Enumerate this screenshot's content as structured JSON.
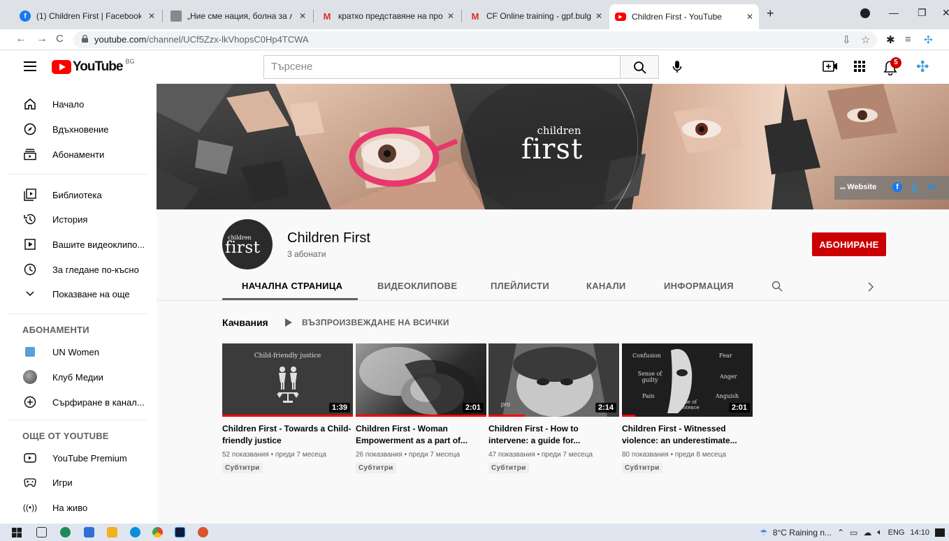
{
  "browser": {
    "tabs": [
      {
        "title": "(1) Children First | Facebook",
        "favicon": "facebook-icon",
        "color": "#1877f2"
      },
      {
        "title": "„Ние сме нация, болна за любо",
        "favicon": "site-icon",
        "color": "#888888"
      },
      {
        "title": "кратко представяне на проекта",
        "favicon": "gmail-icon",
        "color": "#d93025"
      },
      {
        "title": "CF Online training - gpf.bulgaria",
        "favicon": "gmail-icon",
        "color": "#d93025"
      },
      {
        "title": "Children First - YouTube",
        "favicon": "youtube-icon",
        "color": "#ff0000"
      }
    ],
    "url_host": "youtube.com",
    "url_path": "/channel/UCf5Zzx-lkVhopsC0Hp4TCWA"
  },
  "header": {
    "logo_text": "YouTube",
    "country_code": "BG",
    "search_placeholder": "Търсене",
    "notification_count": "5"
  },
  "sidebar": {
    "main_items": [
      {
        "label": "Начало",
        "icon": "home-icon"
      },
      {
        "label": "Вдъхновение",
        "icon": "compass-icon"
      },
      {
        "label": "Абонаменти",
        "icon": "subscriptions-icon"
      }
    ],
    "library_items": [
      {
        "label": "Библиотека",
        "icon": "library-icon"
      },
      {
        "label": "История",
        "icon": "history-icon"
      },
      {
        "label": "Вашите видеоклипо...",
        "icon": "your-videos-icon"
      },
      {
        "label": "За гледане по-късно",
        "icon": "watch-later-icon"
      },
      {
        "label": "Показване на още",
        "icon": "chevron-down-icon"
      }
    ],
    "subscriptions_heading": "АБОНАМЕНТИ",
    "subscriptions": [
      {
        "label": "UN Women",
        "icon": "un-women-avatar"
      },
      {
        "label": "Клуб Медии",
        "icon": "club-media-avatar"
      },
      {
        "label": "Сърфиране в канал...",
        "icon": "add-circle-icon"
      }
    ],
    "more_heading": "ОЩЕ ОТ YOUTUBE",
    "more_items": [
      {
        "label": "YouTube Premium",
        "icon": "youtube-premium-icon"
      },
      {
        "label": "Игри",
        "icon": "gaming-icon"
      },
      {
        "label": "На живо",
        "icon": "live-icon"
      }
    ]
  },
  "banner": {
    "logo_small": "children",
    "logo_big": "first",
    "website_label": "Website",
    "social": [
      "facebook-icon",
      "twitter-icon",
      "linkedin-icon"
    ]
  },
  "channel": {
    "name": "Children First",
    "subscribers": "3 абонати",
    "subscribe_label": "АБОНИРАНЕ",
    "tabs": [
      "НАЧАЛНА СТРАНИЦА",
      "ВИДЕОКЛИПОВЕ",
      "ПЛЕЙЛИСТИ",
      "КАНАЛИ",
      "ИНФОРМАЦИЯ"
    ],
    "active_tab": "НАЧАЛНА СТРАНИЦА"
  },
  "uploads": {
    "title": "Качвания",
    "play_all": "ВЪЗПРОИЗВЕЖДАНЕ НА ВСИЧКИ",
    "videos": [
      {
        "title": "Children First - Towards a Child-friendly justice",
        "duration": "1:39",
        "views": "52 показвания",
        "age": "преди 7 месеца",
        "badge": "Субтитри",
        "watched": 1.0,
        "thumb_text": "Child-friendly justice"
      },
      {
        "title": "Children First - Woman Empowerment as a part of...",
        "duration": "2:01",
        "views": "26 показвания",
        "age": "преди 7 месеца",
        "badge": "Субтитри",
        "watched": 1.0
      },
      {
        "title": "Children First - How to intervene: a guide for...",
        "duration": "2:14",
        "views": "47 показвания",
        "age": "преди 7 месеца",
        "badge": "Субтитри",
        "watched": 0.28,
        "thumb_text": "pro"
      },
      {
        "title": "Children First - Witnessed violence: an underestimate...",
        "duration": "2:01",
        "views": "80 показвания",
        "age": "преди 8 месеца",
        "badge": "Субтитри",
        "watched": 0.1,
        "thumb_words": [
          "Confusion",
          "Fear",
          "Sense of guilty",
          "Anger",
          "Pain",
          "Anguish",
          "Sense of Impotence"
        ]
      }
    ]
  },
  "taskbar": {
    "weather": "8°C  Raining n...",
    "lang": "ENG",
    "time": "14:10"
  },
  "colors": {
    "accent": "#cc0000",
    "yt_red": "#ff0000"
  }
}
